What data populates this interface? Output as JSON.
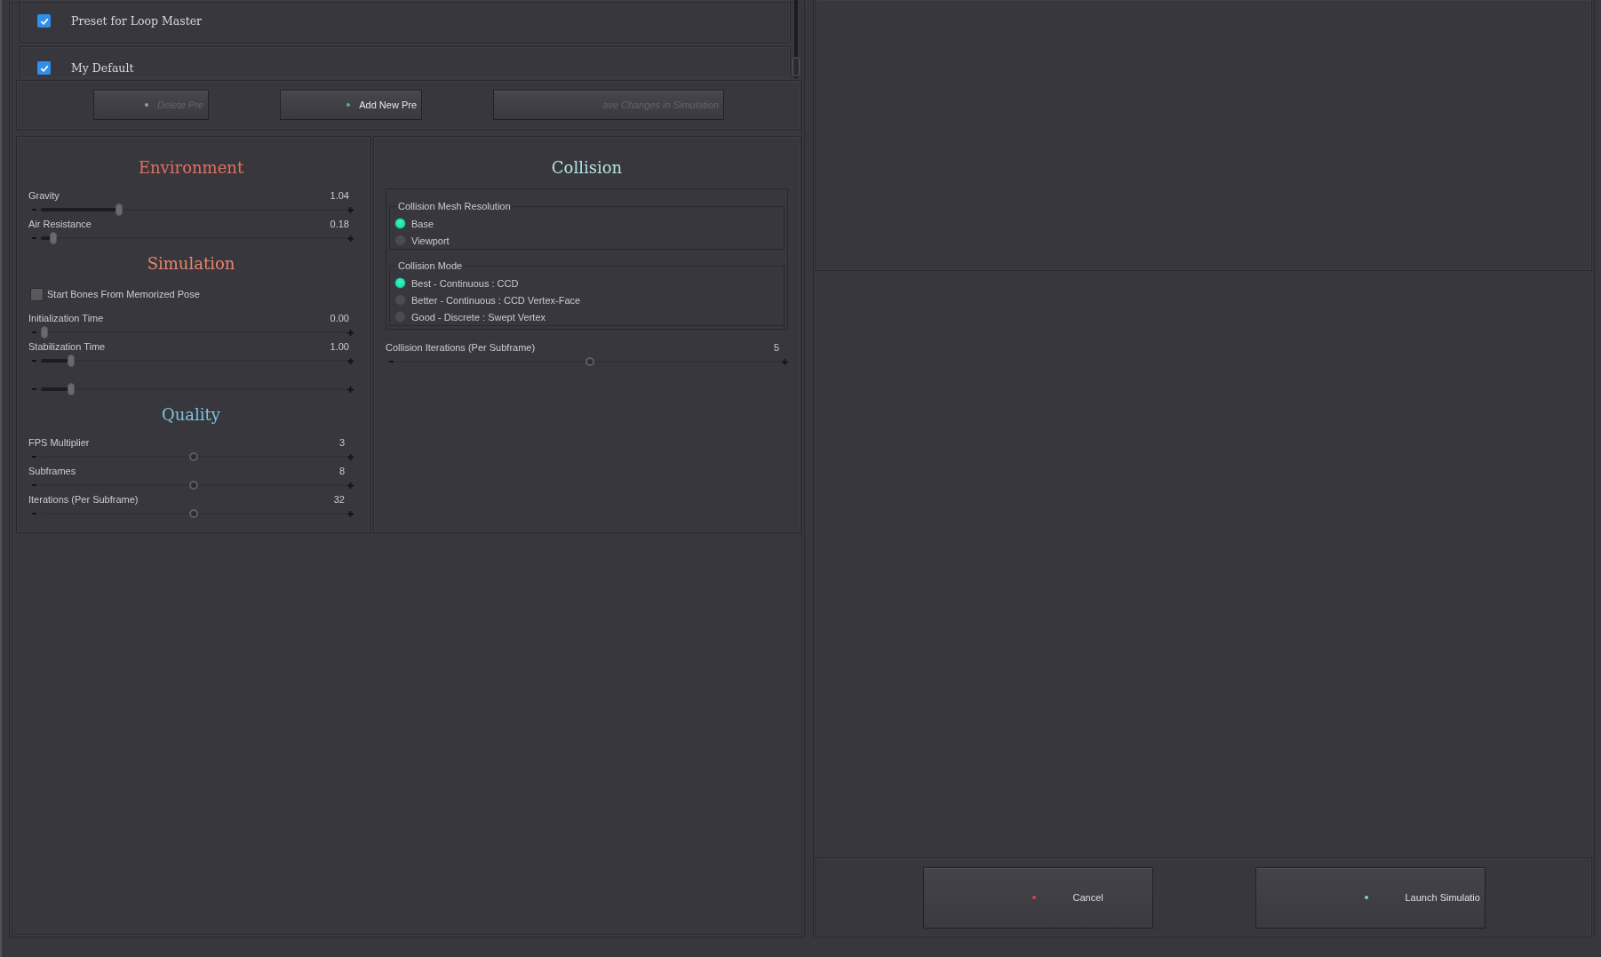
{
  "presets": [
    {
      "label": "Preset for Loop Master",
      "checked": true
    },
    {
      "label": "My Default",
      "checked": true
    }
  ],
  "preset_buttons": [
    {
      "label": "Delete Pre",
      "disabled": true,
      "color": "#9a9a9e"
    },
    {
      "label": "Add New Pre",
      "disabled": false,
      "color": "#3cc46c"
    },
    {
      "label": "ave Changes in Simulation",
      "disabled": true
    }
  ],
  "panels": [
    {
      "sections": [
        {
          "title": "Environment",
          "color": "#e0705f",
          "items": [
            {
              "kind": "range",
              "label": "Gravity",
              "value": "1.04",
              "level": 0.25
            },
            {
              "kind": "range",
              "label": "Air Resistance",
              "value": "0.18",
              "level": 0.03
            }
          ]
        },
        {
          "title": "Simulation",
          "color": "#e8866a",
          "items": [
            {
              "kind": "checkbox",
              "label": "Start Bones From Memorized Pose",
              "checked": false
            },
            {
              "kind": "range",
              "label": "Initialization Time",
              "value": "0.00",
              "level": 0
            },
            {
              "kind": "range",
              "label": "Stabilization Time",
              "value": "1.00",
              "level": 0.09
            },
            {
              "kind": "range",
              "level": 0.09
            }
          ]
        },
        {
          "title": "Quality",
          "color": "#7ec4dc",
          "items": [
            {
              "kind": "knob",
              "label": "FPS Multiplier",
              "value": "3",
              "level": 0.5
            },
            {
              "kind": "knob",
              "label": "Subframes",
              "value": "8",
              "level": 0.5
            },
            {
              "kind": "knob",
              "label": "Iterations (Per Subframe)",
              "value": "32",
              "level": 0.5
            }
          ]
        }
      ]
    },
    {
      "sections": [
        {
          "title": "Collision",
          "color": "#b2e4e2",
          "groups": [
            {
              "legend": "Collision Mesh Resolution",
              "options": [
                {
                  "label": "Base",
                  "selected": true
                },
                {
                  "label": "Viewport",
                  "selected": false
                }
              ]
            },
            {
              "legend": "Collision Mode",
              "options": [
                {
                  "label": "Best - Continuous : CCD",
                  "selected": true
                },
                {
                  "label": "Better - Continuous : CCD Vertex-Face",
                  "selected": false
                },
                {
                  "label": "Good - Discrete : Swept Vertex",
                  "selected": false
                }
              ]
            }
          ],
          "items": [
            {
              "kind": "knob",
              "label": "Collision Iterations (Per Subframe)",
              "value": "5",
              "level": 0.5
            }
          ]
        }
      ]
    }
  ],
  "actions": [
    {
      "label": "Cancel",
      "color": "#d8424e"
    },
    {
      "label": "Launch Simulatio",
      "color": "#70dcc6"
    }
  ]
}
